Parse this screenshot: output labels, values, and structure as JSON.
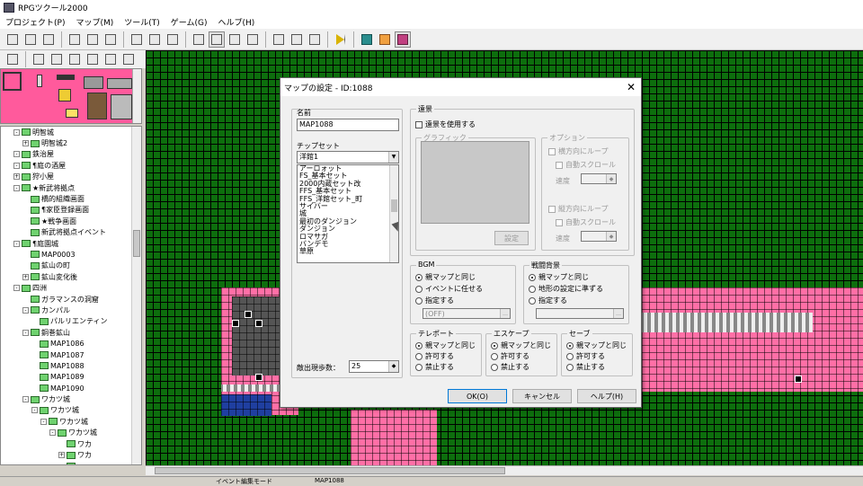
{
  "window": {
    "title": "RPGツクール2000"
  },
  "menubar": [
    "プロジェクト(P)",
    "マップ(M)",
    "ツール(T)",
    "ゲーム(G)",
    "ヘルプ(H)"
  ],
  "toolbar": {
    "row1_icons": [
      "new-project-icon",
      "open-project-icon",
      "close-project-icon",
      "backup-icon",
      "save-icon",
      "revert-icon",
      "map-layer-lower-icon",
      "map-layer-upper-icon",
      "event-layer-icon",
      "zoom-1-1-icon",
      "zoom-1-2-icon",
      "zoom-1-4-icon",
      "zoom-1-8-icon",
      "database-icon",
      "material-icon",
      "music-icon",
      "play-test-icon",
      "fullscreen-icon",
      "title-icon",
      "help-book-icon"
    ],
    "row2_icons": [
      "undo-icon",
      "select-icon",
      "zoom-icon",
      "pencil-icon",
      "rectangle-icon",
      "circle-icon",
      "fill-icon"
    ]
  },
  "map_tree": {
    "items": [
      {
        "label": "明智城",
        "depth": 2,
        "expander": "-"
      },
      {
        "label": "明智城2",
        "depth": 3,
        "expander": "+"
      },
      {
        "label": "鉄治屋",
        "depth": 2,
        "expander": "-"
      },
      {
        "label": "¶庭の酒屋",
        "depth": 2,
        "expander": "-"
      },
      {
        "label": "狩小屋",
        "depth": 2,
        "expander": "+"
      },
      {
        "label": "★新武将拠点",
        "depth": 2,
        "expander": "-"
      },
      {
        "label": "橋的組織画面",
        "depth": 3,
        "expander": ""
      },
      {
        "label": "¶家臣登録画面",
        "depth": 3,
        "expander": ""
      },
      {
        "label": "★戦争画面",
        "depth": 3,
        "expander": ""
      },
      {
        "label": "新武将拠点イベント",
        "depth": 3,
        "expander": ""
      },
      {
        "label": "¶庭園城",
        "depth": 2,
        "expander": "-"
      },
      {
        "label": "MAP0003",
        "depth": 3,
        "expander": ""
      },
      {
        "label": "鉱山の町",
        "depth": 3,
        "expander": ""
      },
      {
        "label": "鉱山変化後",
        "depth": 3,
        "expander": "+"
      },
      {
        "label": "四洲",
        "depth": 2,
        "expander": "-"
      },
      {
        "label": "ガラマンスの洞窟",
        "depth": 3,
        "expander": ""
      },
      {
        "label": "カンパル",
        "depth": 3,
        "expander": "-"
      },
      {
        "label": "パルリエンティン",
        "depth": 4,
        "expander": ""
      },
      {
        "label": "銅巻鉱山",
        "depth": 3,
        "expander": "-"
      },
      {
        "label": "MAP1086",
        "depth": 4,
        "expander": ""
      },
      {
        "label": "MAP1087",
        "depth": 4,
        "expander": ""
      },
      {
        "label": "MAP1088",
        "depth": 4,
        "expander": ""
      },
      {
        "label": "MAP1089",
        "depth": 4,
        "expander": ""
      },
      {
        "label": "MAP1090",
        "depth": 4,
        "expander": ""
      },
      {
        "label": "ワカツ城",
        "depth": 3,
        "expander": "-"
      },
      {
        "label": "ワカツ城",
        "depth": 4,
        "expander": "-"
      },
      {
        "label": "ワカツ城",
        "depth": 5,
        "expander": "-"
      },
      {
        "label": "ワカツ城",
        "depth": 6,
        "expander": "-"
      },
      {
        "label": "ワカ",
        "depth": 7,
        "expander": ""
      },
      {
        "label": "ワカ",
        "depth": 7,
        "expander": "+"
      },
      {
        "label": "",
        "depth": 7,
        "expander": ""
      },
      {
        "label": "",
        "depth": 7,
        "expander": ""
      },
      {
        "label": "薬草",
        "depth": 2,
        "expander": "-"
      }
    ]
  },
  "status": {
    "mode": "イベント編集モード",
    "map": "MAP1088"
  },
  "dialog": {
    "title": "マップの設定 - ID:1088",
    "name_label": "名前",
    "name_value": "MAP1088",
    "tileset_label": "チップセット",
    "tileset_selected": "洋館1",
    "tileset_options": [
      "アーロォット",
      "FS_基本セット",
      "2000内蔵セット改",
      "FFS_基本セット",
      "FFS_洋館セット_町",
      "サイバー",
      "城",
      "最初のダンジョン",
      "ダンジョン",
      "ロマサガ",
      "バンデモ",
      "草原"
    ],
    "encounter_label": "敵出現歩数：",
    "encounter_value": "25",
    "panorama": {
      "title": "遠景",
      "use_label": "遠景を使用する",
      "graphic_title": "グラフィック",
      "settings_button": "設定",
      "options_title": "オプション",
      "h_loop": "横方向にループ",
      "h_auto": "自動スクロール",
      "v_loop": "縦方向にループ",
      "v_auto": "自動スクロール",
      "speed_label": "速度"
    },
    "bgm": {
      "title": "BGM",
      "options": [
        "親マップと同じ",
        "イベントに任せる",
        "指定する"
      ],
      "selected": 0,
      "value": "(OFF)"
    },
    "battle_bg": {
      "title": "戦闘背景",
      "options": [
        "親マップと同じ",
        "地形の設定に準ずる",
        "指定する"
      ],
      "selected": 0
    },
    "teleport": {
      "title": "テレポート",
      "options": [
        "親マップと同じ",
        "許可する",
        "禁止する"
      ],
      "selected": 0
    },
    "escape": {
      "title": "エスケープ",
      "options": [
        "親マップと同じ",
        "許可する",
        "禁止する"
      ],
      "selected": 0
    },
    "save": {
      "title": "セーブ",
      "options": [
        "親マップと同じ",
        "許可する",
        "禁止する"
      ],
      "selected": 0
    },
    "buttons": {
      "ok": "OK(O)",
      "cancel": "キャンセル",
      "help": "ヘルプ(H)"
    }
  }
}
